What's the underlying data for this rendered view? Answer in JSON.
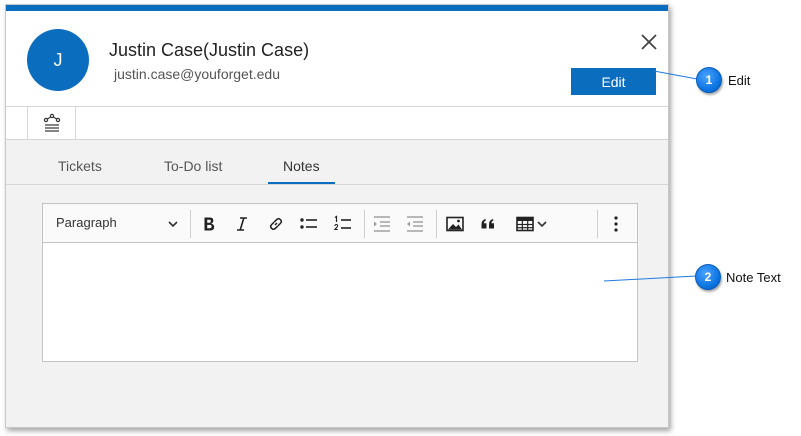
{
  "user": {
    "initial": "J",
    "name": "Justin Case(Justin Case)",
    "email": "justin.case@youforget.edu"
  },
  "actions": {
    "edit_label": "Edit"
  },
  "tabs": [
    {
      "label": "Tickets"
    },
    {
      "label": "To-Do list"
    },
    {
      "label": "Notes"
    }
  ],
  "active_tab": "Notes",
  "editor": {
    "format_value": "Paragraph",
    "text": ""
  },
  "callouts": [
    {
      "number": "1",
      "label": "Edit"
    },
    {
      "number": "2",
      "label": "Note Text"
    }
  ],
  "colors": {
    "accent": "#0b6dbd",
    "callout": "#0a72e0"
  },
  "icons": {
    "close": "close-icon",
    "workflow": "workflow-icon",
    "bold": "bold-icon",
    "italic": "italic-icon",
    "link": "link-icon",
    "bulleted_list": "bulleted-list-icon",
    "numbered_list": "numbered-list-icon",
    "outdent": "outdent-icon",
    "indent": "indent-icon",
    "image": "image-icon",
    "blockquote": "quote-icon",
    "table": "table-icon",
    "more": "more-vertical-icon"
  }
}
